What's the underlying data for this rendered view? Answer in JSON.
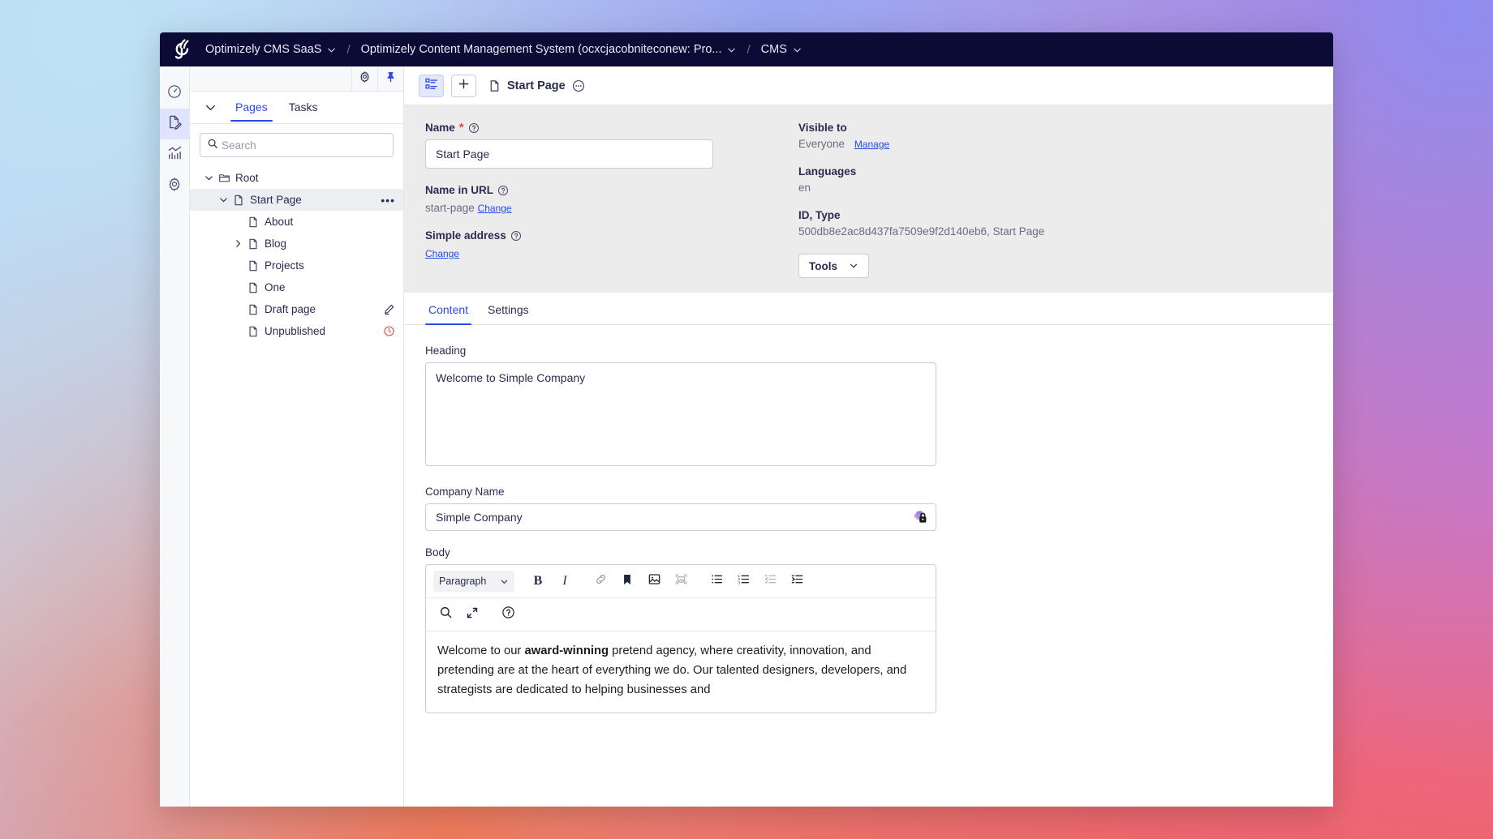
{
  "topbar": {
    "logo_icon": "optimizely-logo-icon",
    "breadcrumbs": [
      {
        "label": "Optimizely CMS SaaS",
        "has_chevron": true
      },
      {
        "label": "Optimizely Content Management System (ocxcjacobniteconew: Pro...",
        "has_chevron": true
      },
      {
        "label": "CMS",
        "has_chevron": true
      }
    ],
    "separator": "/"
  },
  "rail": {
    "items": [
      {
        "icon": "dashboard-gauge-icon",
        "active": false
      },
      {
        "icon": "page-edit-icon",
        "active": true
      },
      {
        "icon": "analytics-chart-icon",
        "active": false
      },
      {
        "icon": "settings-gear-icon",
        "active": false
      }
    ]
  },
  "left_panel": {
    "top_actions": [
      {
        "icon": "gear-icon"
      },
      {
        "icon": "pin-icon"
      }
    ],
    "collapse_icon": "chevron-down-icon",
    "tabs": [
      {
        "label": "Pages",
        "active": true
      },
      {
        "label": "Tasks",
        "active": false
      }
    ],
    "search": {
      "placeholder": "Search",
      "value": "",
      "icon": "search-icon"
    },
    "tree": [
      {
        "label": "Root",
        "icon": "folder-icon",
        "depth": 0,
        "twisty": "down",
        "selected": false,
        "right_icon": ""
      },
      {
        "label": "Start Page",
        "icon": "page-icon",
        "depth": 1,
        "twisty": "down",
        "selected": true,
        "right_icon": "more-dots-icon"
      },
      {
        "label": "About",
        "icon": "page-icon",
        "depth": 2,
        "twisty": "",
        "selected": false,
        "right_icon": ""
      },
      {
        "label": "Blog",
        "icon": "page-icon",
        "depth": 2,
        "twisty": "right",
        "selected": false,
        "right_icon": ""
      },
      {
        "label": "Projects",
        "icon": "page-icon",
        "depth": 2,
        "twisty": "",
        "selected": false,
        "right_icon": ""
      },
      {
        "label": "One",
        "icon": "page-icon",
        "depth": 2,
        "twisty": "",
        "selected": false,
        "right_icon": ""
      },
      {
        "label": "Draft page",
        "icon": "page-icon",
        "depth": 2,
        "twisty": "",
        "selected": false,
        "right_icon": "pencil-draft-icon"
      },
      {
        "label": "Unpublished",
        "icon": "page-icon",
        "depth": 2,
        "twisty": "",
        "selected": false,
        "right_icon": "clock-unpublished-icon"
      }
    ]
  },
  "content_toolbar": {
    "outline_button_icon": "page-outline-icon",
    "add_button_icon": "plus-icon",
    "page_icon": "page-icon",
    "title": "Start Page",
    "more_icon": "more-circle-icon"
  },
  "info_panel": {
    "name": {
      "label": "Name",
      "required_marker": "*",
      "help_icon": "help-circle-icon",
      "value": "Start Page"
    },
    "name_in_url": {
      "label": "Name in URL",
      "help_icon": "help-circle-icon",
      "value": "start-page",
      "change_link": "Change"
    },
    "simple_address": {
      "label": "Simple address",
      "help_icon": "help-circle-icon",
      "change_link": "Change"
    },
    "visible_to": {
      "label": "Visible to",
      "value": "Everyone",
      "manage_link": "Manage"
    },
    "languages": {
      "label": "Languages",
      "value": "en"
    },
    "id_type": {
      "label": "ID, Type",
      "value": "500db8e2ac8d437fa7509e9f2d140eb6, Start Page"
    },
    "tools_button": {
      "label": "Tools",
      "chevron_icon": "chevron-down-icon"
    }
  },
  "content_tabs": [
    {
      "label": "Content",
      "active": true
    },
    {
      "label": "Settings",
      "active": false
    }
  ],
  "form": {
    "heading": {
      "label": "Heading",
      "value": "Welcome to Simple Company"
    },
    "company_name": {
      "label": "Company Name",
      "value": "Simple Company",
      "badge_icon": "ai-locked-field-icon"
    },
    "body": {
      "label": "Body",
      "toolbar_row1": [
        {
          "name": "paragraph-style-select",
          "label": "Paragraph",
          "type": "select"
        },
        {
          "name": "bold-button",
          "label": "B",
          "type": "text-icon"
        },
        {
          "name": "italic-button",
          "label": "I",
          "type": "text-icon"
        },
        {
          "name": "link-button",
          "icon": "link-icon"
        },
        {
          "name": "bookmark-button",
          "icon": "bookmark-icon"
        },
        {
          "name": "insert-image-button",
          "icon": "image-icon"
        },
        {
          "name": "insert-media-button",
          "icon": "media-icon",
          "disabled": true
        },
        {
          "name": "bullet-list-button",
          "icon": "bullet-list-icon"
        },
        {
          "name": "numbered-list-button",
          "icon": "numbered-list-icon"
        },
        {
          "name": "outdent-button",
          "icon": "outdent-icon"
        },
        {
          "name": "indent-button",
          "icon": "indent-icon"
        }
      ],
      "toolbar_row2": [
        {
          "name": "find-replace-button",
          "icon": "search-icon"
        },
        {
          "name": "fullscreen-button",
          "icon": "fullscreen-icon"
        },
        {
          "name": "help-button",
          "icon": "help-circle-icon"
        }
      ],
      "content_parts": [
        {
          "text": "Welcome to our ",
          "bold": false
        },
        {
          "text": "award-winning",
          "bold": true
        },
        {
          "text": " pretend agency, where creativity, innovation, and pretending are at the heart of everything we do. Our talented designers, developers, and strategists are dedicated to helping businesses and",
          "bold": false
        }
      ]
    }
  },
  "colors": {
    "accent_blue": "#2a4ae8",
    "topbar_navy": "#0b0b35",
    "danger_red": "#e0493c",
    "panel_gray": "#ececec"
  }
}
